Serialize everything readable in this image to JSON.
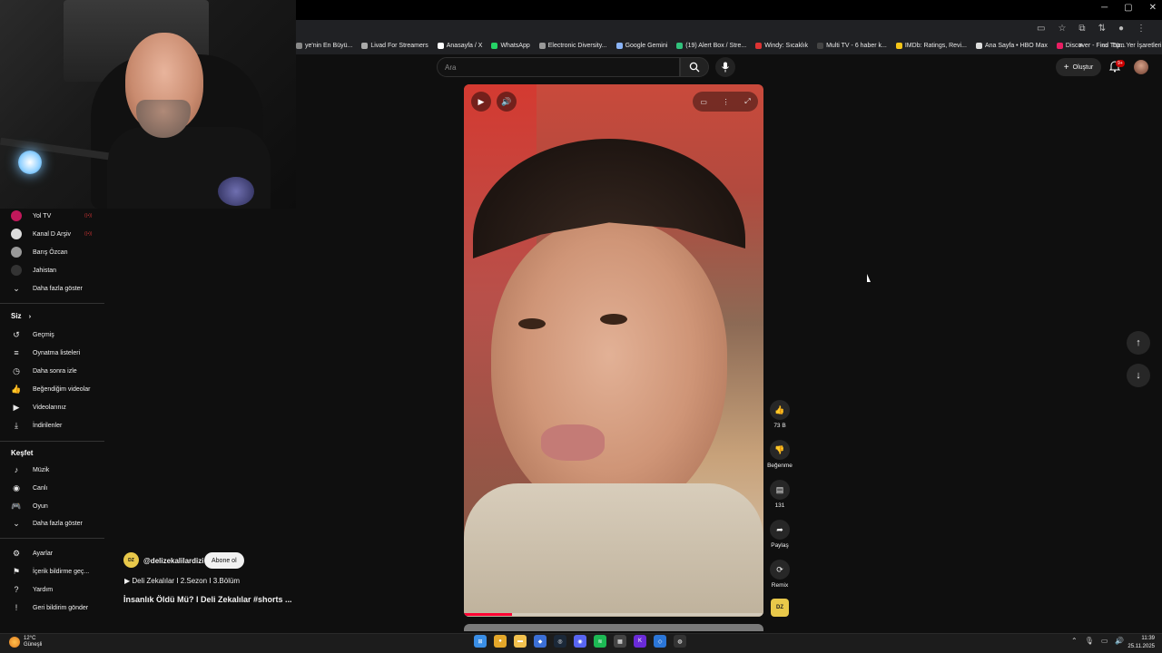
{
  "window": {
    "minimize": "─",
    "maximize": "▢",
    "close": "✕"
  },
  "bookmarks": {
    "items": [
      {
        "label": "ye'nin En Büyü...",
        "color": "#888"
      },
      {
        "label": "Livad For Streamers",
        "color": "#aaa"
      },
      {
        "label": "Anasayfa / X",
        "color": "#fff"
      },
      {
        "label": "WhatsApp",
        "color": "#25d366"
      },
      {
        "label": "Electronic Diversity...",
        "color": "#999"
      },
      {
        "label": "Google Gemini",
        "color": "#8ab4f8"
      },
      {
        "label": "(19) Alert Box / Stre...",
        "color": "#31c27c"
      },
      {
        "label": "Windy: Sıcaklık",
        "color": "#d33"
      },
      {
        "label": "Multi TV - 6 haber k...",
        "color": "#444"
      },
      {
        "label": "IMDb: Ratings, Revi...",
        "color": "#f5c518"
      },
      {
        "label": "Ana Sayfa • HBO Max",
        "color": "#ddd"
      },
      {
        "label": "Discover - Find Top...",
        "color": "#e91e63"
      }
    ],
    "more": "»",
    "all_bookmarks": "Tüm Yer İşaretleri"
  },
  "sidebar": {
    "subscriptions": [
      {
        "label": "Yol TV",
        "color": "#c2185b",
        "live": true
      },
      {
        "label": "Kanal D Arşiv",
        "color": "#ddd",
        "live": true
      },
      {
        "label": "Barış Özcan",
        "color": "#999",
        "live": false
      },
      {
        "label": "Jahistan",
        "color": "#333",
        "live": false
      }
    ],
    "show_more_subs": "Daha fazla göster",
    "you_header": "Siz",
    "you_items": [
      {
        "label": "Geçmiş",
        "icon": "↺"
      },
      {
        "label": "Oynatma listeleri",
        "icon": "≡"
      },
      {
        "label": "Daha sonra izle",
        "icon": "◷"
      },
      {
        "label": "Beğendiğim videolar",
        "icon": "👍"
      },
      {
        "label": "Videolarınız",
        "icon": "▶"
      },
      {
        "label": "İndirilenler",
        "icon": "⤓"
      }
    ],
    "explore_header": "Keşfet",
    "explore_items": [
      {
        "label": "Müzik",
        "icon": "♪"
      },
      {
        "label": "Canlı",
        "icon": "◉"
      },
      {
        "label": "Oyun",
        "icon": "🎮"
      }
    ],
    "show_more_explore": "Daha fazla göster",
    "bottom_items": [
      {
        "label": "Ayarlar",
        "icon": "⚙"
      },
      {
        "label": "İçerik bildirme geç...",
        "icon": "⚑"
      },
      {
        "label": "Yardım",
        "icon": "?"
      },
      {
        "label": "Geri bildirim gönder",
        "icon": "!"
      }
    ]
  },
  "search": {
    "placeholder": "Ara"
  },
  "header": {
    "create_label": "Oluştur",
    "notif_badge": "9+"
  },
  "video": {
    "progress_fraction": 0.16,
    "channel_handle": "@delizekalilardizi",
    "subscribe_label": "Abone ol",
    "playlist": "▶ Deli Zekalılar I 2.Sezon I 3.Bölüm",
    "title": "İnsanlık Öldü Mü? I Deli Zekalılar #shorts ..."
  },
  "actions": {
    "like_count": "73 B",
    "dislike_label": "Beğenme",
    "comments_count": "131",
    "share_label": "Paylaş",
    "remix_label": "Remix",
    "channel_thumb_text": "DZ"
  },
  "taskbar": {
    "temperature": "12°C",
    "weather_desc": "Güneşli",
    "time": "11:39",
    "date": "25.11.2025",
    "apps": [
      {
        "icon": "windows-icon",
        "color": "#3a8ee6",
        "glyph": "⊞"
      },
      {
        "icon": "chrome-icon",
        "color": "#e4a72a",
        "glyph": "●"
      },
      {
        "icon": "folder-icon",
        "color": "#f2c14e",
        "glyph": "▬"
      },
      {
        "icon": "app-icon",
        "color": "#3b6fd6",
        "glyph": "◆"
      },
      {
        "icon": "steam-icon",
        "color": "#1b2838",
        "glyph": "◎"
      },
      {
        "icon": "discord-icon",
        "color": "#5865f2",
        "glyph": "◉"
      },
      {
        "icon": "spotify-icon",
        "color": "#1db954",
        "glyph": "≋"
      },
      {
        "icon": "calculator-icon",
        "color": "#444",
        "glyph": "▦"
      },
      {
        "icon": "kick-icon",
        "color": "#6a2bd8",
        "glyph": "K"
      },
      {
        "icon": "app2-icon",
        "color": "#2b76d8",
        "glyph": "◇"
      },
      {
        "icon": "obs-icon",
        "color": "#333",
        "glyph": "◍"
      }
    ]
  }
}
